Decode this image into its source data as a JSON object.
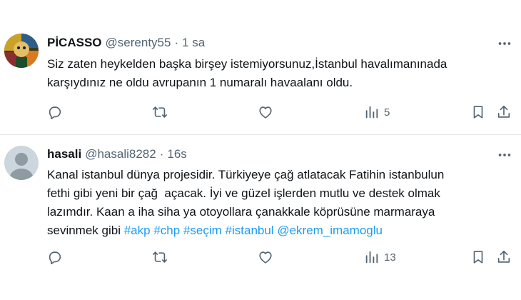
{
  "tweets": [
    {
      "name": "PİCASSO",
      "handle": "@serenty55",
      "separator": "·",
      "time": "1 sa",
      "lines": [
        "Siz zaten heykelden başka birşey istemiyorsunuz,İstanbul havalımanınada",
        "karşıydınız ne oldu avrupanın 1 numaralı havaalanı oldu."
      ],
      "views": "5"
    },
    {
      "name": "hasali",
      "handle": "@hasali8282",
      "separator": "·",
      "time": "16s",
      "lines": [
        "Kanal istanbul dünya projesidir. Türkiyeye çağ atlatacak Fatihin istanbulun",
        "fethi gibi yeni bir çağ  açacak. İyi ve güzel işlerden mutlu ve destek olmak",
        "lazımdır. Kaan a iha siha ya otoyollara çanakkale köprüsüne marmaraya",
        "sevinmek gibi "
      ],
      "hashtags": [
        "#akp",
        "#chp",
        "#seçim",
        "#istanbul",
        "@ekrem_imamoglu"
      ],
      "views": "13"
    }
  ],
  "colors": {
    "text": "#0f1419",
    "secondary": "#536471",
    "link": "#1d9bf0",
    "divider": "#e6e9eb"
  },
  "icons": [
    "more-icon",
    "reply-icon",
    "retweet-icon",
    "like-icon",
    "views-icon",
    "bookmark-icon",
    "share-icon"
  ]
}
